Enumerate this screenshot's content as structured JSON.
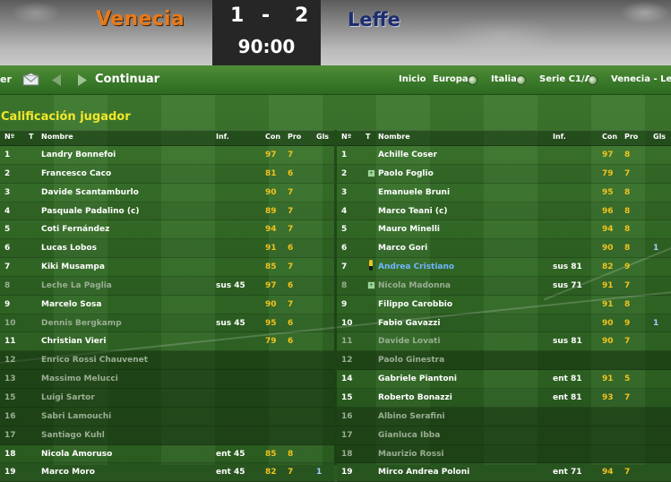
{
  "header": {
    "home_team": "Venecia",
    "away_team": "Leffe",
    "home_goals": "1",
    "away_goals": "2",
    "separator": "-",
    "clock": "90:00"
  },
  "nav": {
    "back_label": "er",
    "continue_label": "Continuar",
    "breadcrumbs": [
      "Inicio",
      "Europa",
      "Italia",
      "Serie C1/A",
      "Venecia - Leffe"
    ]
  },
  "section_title": "Calificación jugador",
  "columns": {
    "num": "Nº",
    "t": "T",
    "name": "Nombre",
    "inf": "Inf.",
    "con": "Con",
    "pro": "Pro",
    "gls": "Gls"
  },
  "home_players": [
    {
      "num": "1",
      "name": "Landry Bonnefoi",
      "inf": "",
      "con": "97",
      "pro": "7",
      "gls": "",
      "dim": false
    },
    {
      "num": "2",
      "name": "Francesco Caco",
      "inf": "",
      "con": "81",
      "pro": "6",
      "gls": "",
      "dim": false
    },
    {
      "num": "3",
      "name": "Davide Scantamburlo",
      "inf": "",
      "con": "90",
      "pro": "7",
      "gls": "",
      "dim": false
    },
    {
      "num": "4",
      "name": "Pasquale Padalino (c)",
      "inf": "",
      "con": "89",
      "pro": "7",
      "gls": "",
      "dim": false
    },
    {
      "num": "5",
      "name": "Coti Fernández",
      "inf": "",
      "con": "94",
      "pro": "7",
      "gls": "",
      "dim": false
    },
    {
      "num": "6",
      "name": "Lucas Lobos",
      "inf": "",
      "con": "91",
      "pro": "6",
      "gls": "",
      "dim": false
    },
    {
      "num": "7",
      "name": "Kiki Musampa",
      "inf": "",
      "con": "85",
      "pro": "7",
      "gls": "",
      "dim": false
    },
    {
      "num": "8",
      "name": "Leche La Paglia",
      "inf": "sus 45",
      "con": "97",
      "pro": "6",
      "gls": "",
      "dim": true
    },
    {
      "num": "9",
      "name": "Marcelo Sosa",
      "inf": "",
      "con": "90",
      "pro": "7",
      "gls": "",
      "dim": false
    },
    {
      "num": "10",
      "name": "Dennis Bergkamp",
      "inf": "sus 45",
      "con": "95",
      "pro": "6",
      "gls": "",
      "dim": true
    },
    {
      "num": "11",
      "name": "Christian Vieri",
      "inf": "",
      "con": "79",
      "pro": "6",
      "gls": "",
      "dim": false
    },
    {
      "num": "12",
      "name": "Enrico Rossi Chauvenet",
      "inf": "",
      "con": "",
      "pro": "",
      "gls": "",
      "dim": true
    },
    {
      "num": "13",
      "name": "Massimo Melucci",
      "inf": "",
      "con": "",
      "pro": "",
      "gls": "",
      "dim": true
    },
    {
      "num": "15",
      "name": "Luigi Sartor",
      "inf": "",
      "con": "",
      "pro": "",
      "gls": "",
      "dim": true
    },
    {
      "num": "16",
      "name": "Sabri Lamouchi",
      "inf": "",
      "con": "",
      "pro": "",
      "gls": "",
      "dim": true
    },
    {
      "num": "17",
      "name": "Santiago Kuhl",
      "inf": "",
      "con": "",
      "pro": "",
      "gls": "",
      "dim": true
    },
    {
      "num": "18",
      "name": "Nicola Amoruso",
      "inf": "ent 45",
      "con": "85",
      "pro": "8",
      "gls": "",
      "dim": false
    },
    {
      "num": "19",
      "name": "Marco Moro",
      "inf": "ent 45",
      "con": "82",
      "pro": "7",
      "gls": "1",
      "dim": false
    }
  ],
  "away_players": [
    {
      "num": "1",
      "name": "Achille Coser",
      "inf": "",
      "con": "97",
      "pro": "8",
      "gls": "",
      "dim": false,
      "icon": ""
    },
    {
      "num": "2",
      "name": "Paolo Foglio",
      "inf": "",
      "con": "79",
      "pro": "7",
      "gls": "",
      "dim": false,
      "icon": "plus"
    },
    {
      "num": "3",
      "name": "Emanuele Bruni",
      "inf": "",
      "con": "95",
      "pro": "8",
      "gls": "",
      "dim": false,
      "icon": ""
    },
    {
      "num": "4",
      "name": "Marco Teani (c)",
      "inf": "",
      "con": "96",
      "pro": "8",
      "gls": "",
      "dim": false,
      "icon": ""
    },
    {
      "num": "5",
      "name": "Mauro Minelli",
      "inf": "",
      "con": "94",
      "pro": "8",
      "gls": "",
      "dim": false,
      "icon": ""
    },
    {
      "num": "6",
      "name": "Marco Gori",
      "inf": "",
      "con": "90",
      "pro": "8",
      "gls": "1",
      "dim": false,
      "icon": ""
    },
    {
      "num": "7",
      "name": "Andrea Cristiano",
      "inf": "sus 81",
      "con": "82",
      "pro": "9",
      "gls": "",
      "dim": false,
      "blue": true,
      "icon": "pin"
    },
    {
      "num": "8",
      "name": "Nicola Madonna",
      "inf": "sus 71",
      "con": "91",
      "pro": "7",
      "gls": "",
      "dim": true,
      "icon": "plus"
    },
    {
      "num": "9",
      "name": "Filippo Carobbio",
      "inf": "",
      "con": "91",
      "pro": "8",
      "gls": "",
      "dim": false,
      "icon": ""
    },
    {
      "num": "10",
      "name": "Fabio Gavazzi",
      "inf": "",
      "con": "90",
      "pro": "9",
      "gls": "1",
      "dim": false,
      "icon": ""
    },
    {
      "num": "11",
      "name": "Davide Lovati",
      "inf": "sus 81",
      "con": "90",
      "pro": "7",
      "gls": "",
      "dim": true,
      "icon": ""
    },
    {
      "num": "12",
      "name": "Paolo Ginestra",
      "inf": "",
      "con": "",
      "pro": "",
      "gls": "",
      "dim": true,
      "icon": ""
    },
    {
      "num": "14",
      "name": "Gabriele Piantoni",
      "inf": "ent 81",
      "con": "91",
      "pro": "5",
      "gls": "",
      "dim": false,
      "icon": ""
    },
    {
      "num": "15",
      "name": "Roberto Bonazzi",
      "inf": "ent 81",
      "con": "93",
      "pro": "7",
      "gls": "",
      "dim": false,
      "icon": ""
    },
    {
      "num": "16",
      "name": "Albino Serafini",
      "inf": "",
      "con": "",
      "pro": "",
      "gls": "",
      "dim": true,
      "icon": ""
    },
    {
      "num": "17",
      "name": "Gianluca Ibba",
      "inf": "",
      "con": "",
      "pro": "",
      "gls": "",
      "dim": true,
      "icon": ""
    },
    {
      "num": "18",
      "name": "Maurizio Rossi",
      "inf": "",
      "con": "",
      "pro": "",
      "gls": "",
      "dim": true,
      "icon": ""
    },
    {
      "num": "19",
      "name": "Mirco Andrea Poloni",
      "inf": "ent 71",
      "con": "94",
      "pro": "7",
      "gls": "",
      "dim": false,
      "icon": ""
    }
  ],
  "colors": {
    "home": "#e87a1a",
    "away": "#1d2d6e",
    "title": "#f2e82a",
    "rating": "#f2c21e"
  },
  "icons": [
    "mail-icon",
    "back-arrow-icon",
    "forward-arrow-icon",
    "dropdown-dot-icon",
    "substitution-icon",
    "booking-icon"
  ]
}
